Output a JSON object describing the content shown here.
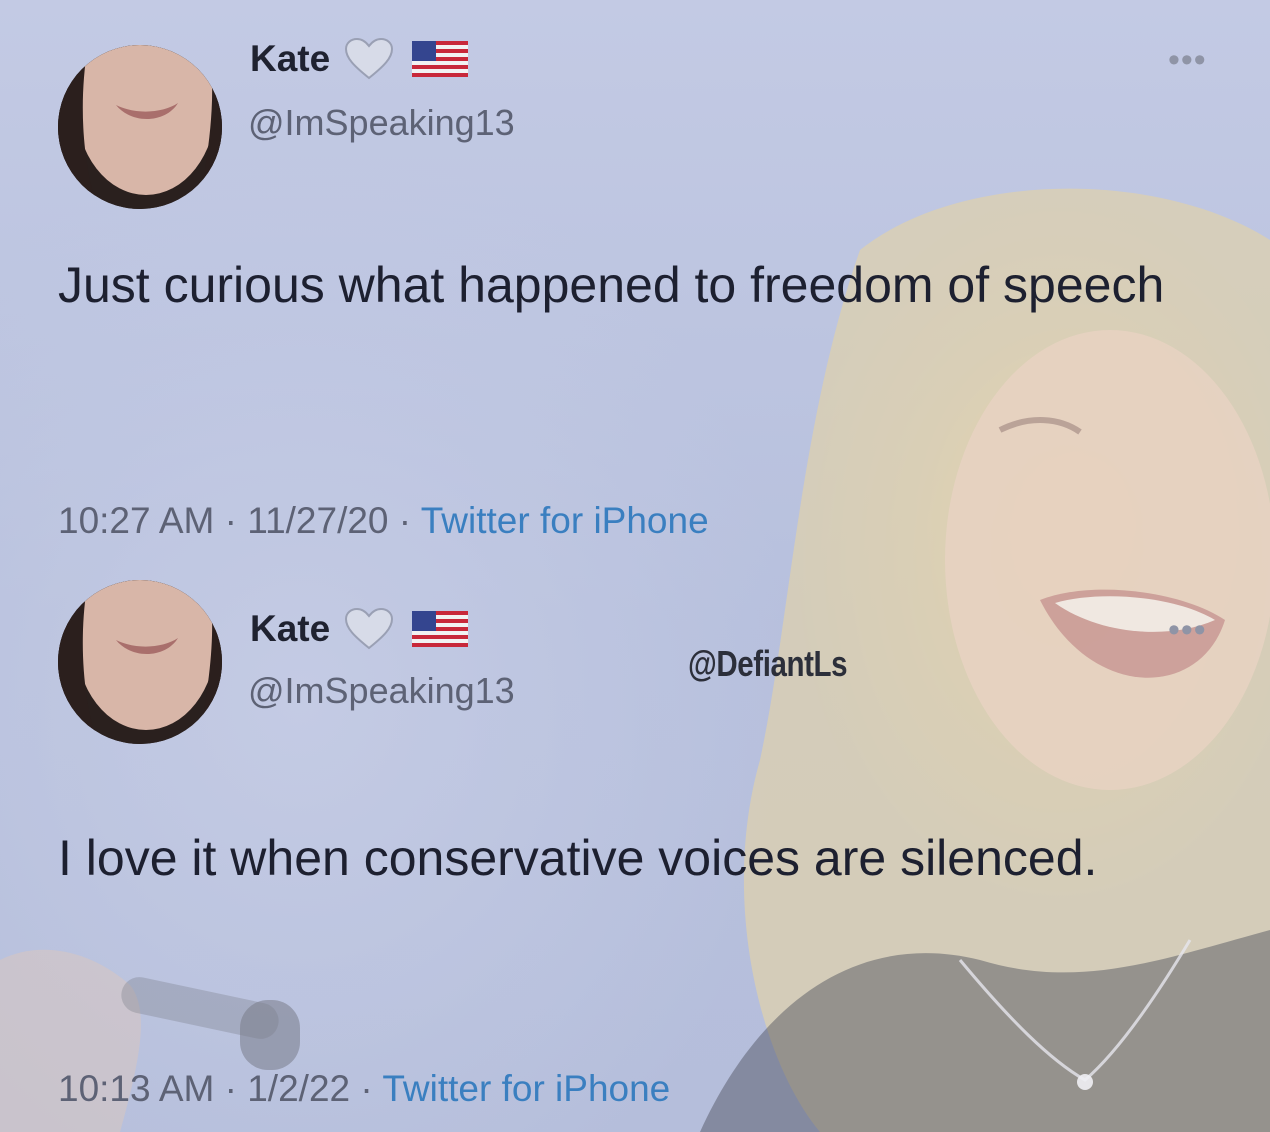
{
  "watermark": "@DefiantLs",
  "tweets": [
    {
      "name": "Kate",
      "handle": "@ImSpeaking13",
      "badges": [
        "white-heart-icon",
        "us-flag-icon"
      ],
      "text": "Just curious what happened to freedom of speech",
      "time": "10:27 AM",
      "date": "11/27/20",
      "separator": "·",
      "source": "Twitter for iPhone"
    },
    {
      "name": "Kate",
      "handle": "@ImSpeaking13",
      "badges": [
        "white-heart-icon",
        "us-flag-icon"
      ],
      "text": "I love it when conservative voices are silenced.",
      "time": "10:13 AM",
      "date": "1/2/22",
      "separator": "·",
      "source": "Twitter for iPhone"
    }
  ],
  "colors": {
    "background": "#b9c2de",
    "text": "#1d2030",
    "secondary": "#5d6275",
    "link": "#3a7fc0"
  }
}
